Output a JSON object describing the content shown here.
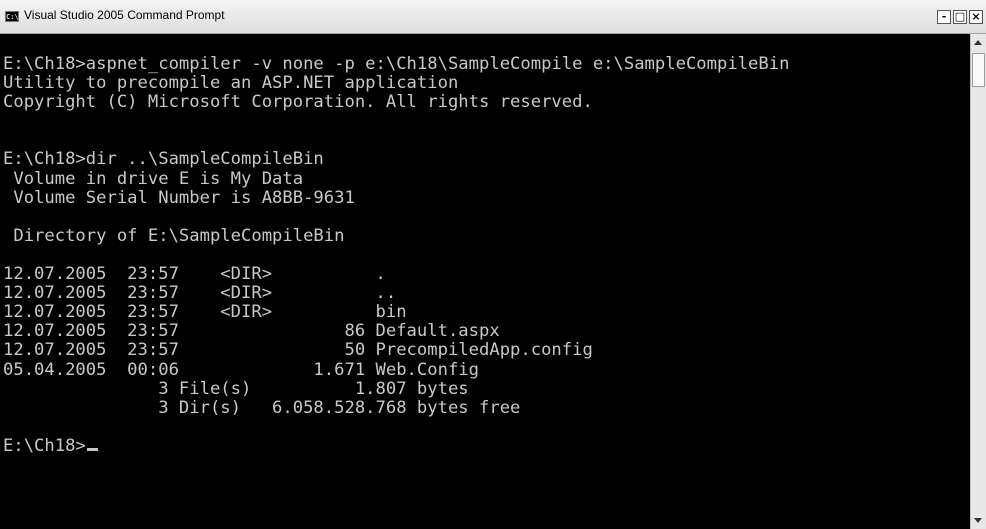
{
  "window": {
    "title": "Visual Studio 2005 Command Prompt",
    "icon_text": "C:\\",
    "controls": {
      "minimize": "-",
      "maximize": "□",
      "close": "×"
    }
  },
  "console": {
    "lines": [
      "E:\\Ch18>aspnet_compiler -v none -p e:\\Ch18\\SampleCompile e:\\SampleCompileBin",
      "Utility to precompile an ASP.NET application",
      "Copyright (C) Microsoft Corporation. All rights reserved.",
      "",
      "",
      "E:\\Ch18>dir ..\\SampleCompileBin",
      " Volume in drive E is My Data",
      " Volume Serial Number is A8BB-9631",
      "",
      " Directory of E:\\SampleCompileBin",
      "",
      "12.07.2005  23:57    <DIR>          .",
      "12.07.2005  23:57    <DIR>          ..",
      "12.07.2005  23:57    <DIR>          bin",
      "12.07.2005  23:57                86 Default.aspx",
      "12.07.2005  23:57                50 PrecompiledApp.config",
      "05.04.2005  00:06             1.671 Web.Config",
      "               3 File(s)          1.807 bytes",
      "               3 Dir(s)   6.058.528.768 bytes free",
      ""
    ],
    "prompt": "E:\\Ch18>"
  },
  "icons": {
    "app": "command-prompt-icon",
    "scroll_up": "arrow-up-icon",
    "scroll_down": "arrow-down-icon"
  },
  "colors": {
    "background": "#000000",
    "text": "#c8c8c8",
    "titlebar": "#e8e8e8"
  }
}
